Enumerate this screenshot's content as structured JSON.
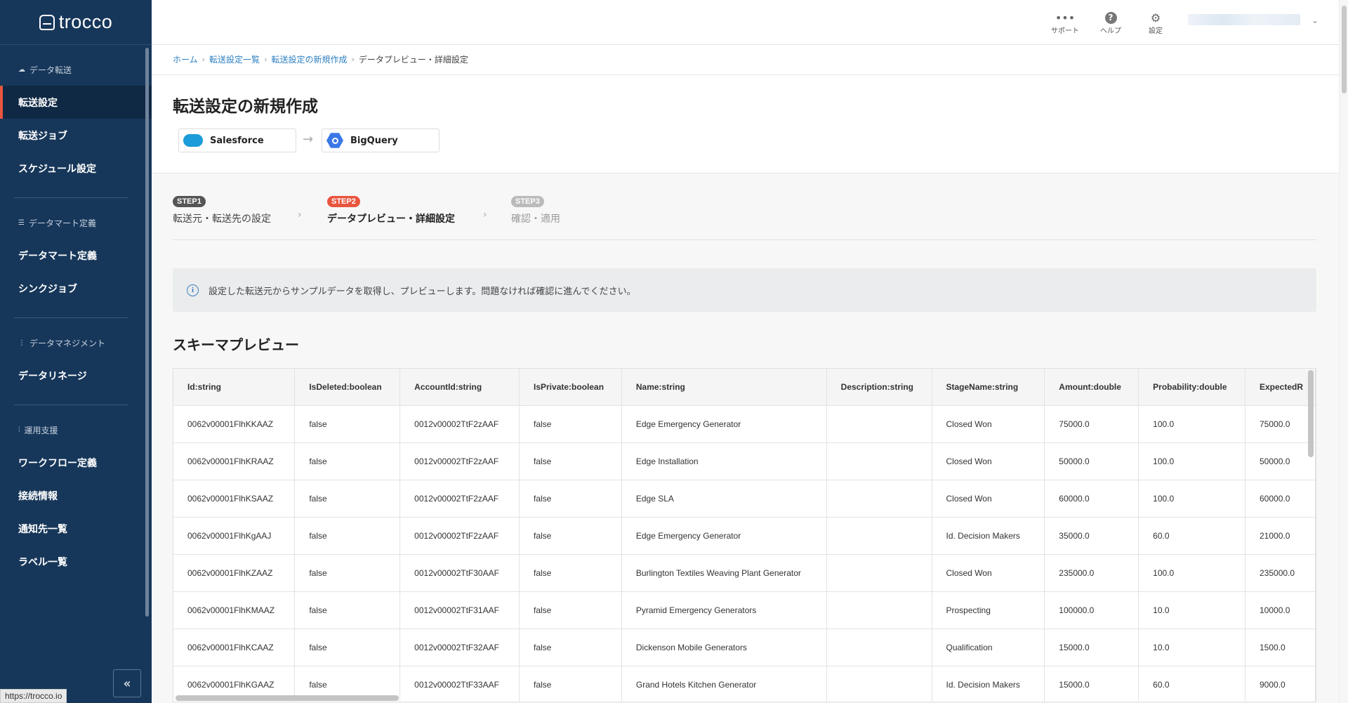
{
  "app": {
    "logo_text": "trocco"
  },
  "sidebar": {
    "sections": [
      {
        "heading": "データ転送",
        "items": [
          "転送設定",
          "転送ジョブ",
          "スケジュール設定"
        ]
      },
      {
        "heading": "データマート定義",
        "items": [
          "データマート定義",
          "シンクジョブ"
        ]
      },
      {
        "heading": "データマネジメント",
        "items": [
          "データリネージ"
        ]
      },
      {
        "heading": "運用支援",
        "items": [
          "ワークフロー定義",
          "接続情報",
          "通知先一覧",
          "ラベル一覧"
        ]
      }
    ],
    "active_item": "転送設定",
    "collapse_label": "«"
  },
  "status_url": "https://trocco.io",
  "topbar": {
    "support_label": "サポート",
    "help_label": "ヘルプ",
    "settings_label": "設定"
  },
  "breadcrumb": {
    "links": [
      "ホーム",
      "転送設定一覧",
      "転送設定の新規作成"
    ],
    "current": "データプレビュー・詳細設定"
  },
  "page_title": "転送設定の新規作成",
  "connection": {
    "source": "Salesforce",
    "destination": "BigQuery"
  },
  "steps": [
    {
      "badge": "STEP1",
      "label": "転送元・転送先の設定",
      "state": "done",
      "color": "#555555"
    },
    {
      "badge": "STEP2",
      "label": "データプレビュー・詳細設定",
      "state": "active",
      "color": "#e8553e"
    },
    {
      "badge": "STEP3",
      "label": "確認・適用",
      "state": "pending",
      "color": "#bbbbbb"
    }
  ],
  "info_text": "設定した転送元からサンプルデータを取得し、プレビューします。問題なければ確認に進んでください。",
  "schema_title": "スキーマプレビュー",
  "table": {
    "columns": [
      "Id:string",
      "IsDeleted:boolean",
      "AccountId:string",
      "IsPrivate:boolean",
      "Name:string",
      "Description:string",
      "StageName:string",
      "Amount:double",
      "Probability:double",
      "ExpectedR"
    ],
    "rows": [
      [
        "0062v00001FlhKKAAZ",
        "false",
        "0012v00002TtF2zAAF",
        "false",
        "Edge Emergency Generator",
        "",
        "Closed Won",
        "75000.0",
        "100.0",
        "75000.0"
      ],
      [
        "0062v00001FlhKRAAZ",
        "false",
        "0012v00002TtF2zAAF",
        "false",
        "Edge Installation",
        "",
        "Closed Won",
        "50000.0",
        "100.0",
        "50000.0"
      ],
      [
        "0062v00001FlhKSAAZ",
        "false",
        "0012v00002TtF2zAAF",
        "false",
        "Edge SLA",
        "",
        "Closed Won",
        "60000.0",
        "100.0",
        "60000.0"
      ],
      [
        "0062v00001FlhKgAAJ",
        "false",
        "0012v00002TtF2zAAF",
        "false",
        "Edge Emergency Generator",
        "",
        "Id. Decision Makers",
        "35000.0",
        "60.0",
        "21000.0"
      ],
      [
        "0062v00001FlhKZAAZ",
        "false",
        "0012v00002TtF30AAF",
        "false",
        "Burlington Textiles Weaving Plant Generator",
        "",
        "Closed Won",
        "235000.0",
        "100.0",
        "235000.0"
      ],
      [
        "0062v00001FlhKMAAZ",
        "false",
        "0012v00002TtF31AAF",
        "false",
        "Pyramid Emergency Generators",
        "",
        "Prospecting",
        "100000.0",
        "10.0",
        "10000.0"
      ],
      [
        "0062v00001FlhKCAAZ",
        "false",
        "0012v00002TtF32AAF",
        "false",
        "Dickenson Mobile Generators",
        "",
        "Qualification",
        "15000.0",
        "10.0",
        "1500.0"
      ],
      [
        "0062v00001FlhKGAAZ",
        "false",
        "0012v00002TtF33AAF",
        "false",
        "Grand Hotels Kitchen Generator",
        "",
        "Id. Decision Makers",
        "15000.0",
        "60.0",
        "9000.0"
      ]
    ]
  },
  "colors": {
    "sidebar_bg": "#17375a",
    "accent": "#e8553e",
    "link": "#2d7fc1"
  }
}
